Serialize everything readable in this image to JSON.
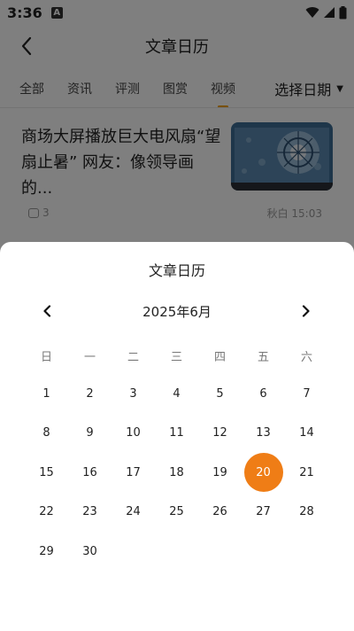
{
  "status_bar": {
    "time": "3:36",
    "notif_letter": "A"
  },
  "header": {
    "title": "文章日历"
  },
  "tabs": [
    {
      "label": "全部"
    },
    {
      "label": "资讯"
    },
    {
      "label": "评测"
    },
    {
      "label": "图赏"
    },
    {
      "label": "视频",
      "active": true
    }
  ],
  "date_filter": {
    "label": "选择日期"
  },
  "article": {
    "title": "商场大屏播放巨大电风扇“望扇止暑” 网友：像领导画的...",
    "comments": "3",
    "author_time": "秋白 15:03"
  },
  "calendar": {
    "title": "文章日历",
    "month_label": "2025年6月",
    "weekdays": [
      "日",
      "一",
      "二",
      "三",
      "四",
      "五",
      "六"
    ],
    "days": [
      "1",
      "2",
      "3",
      "4",
      "5",
      "6",
      "7",
      "8",
      "9",
      "10",
      "11",
      "12",
      "13",
      "14",
      "15",
      "16",
      "17",
      "18",
      "19",
      "20",
      "21",
      "22",
      "23",
      "24",
      "25",
      "26",
      "27",
      "28",
      "29",
      "30"
    ],
    "selected_day": "20",
    "accent_color": "#ef7d16"
  }
}
